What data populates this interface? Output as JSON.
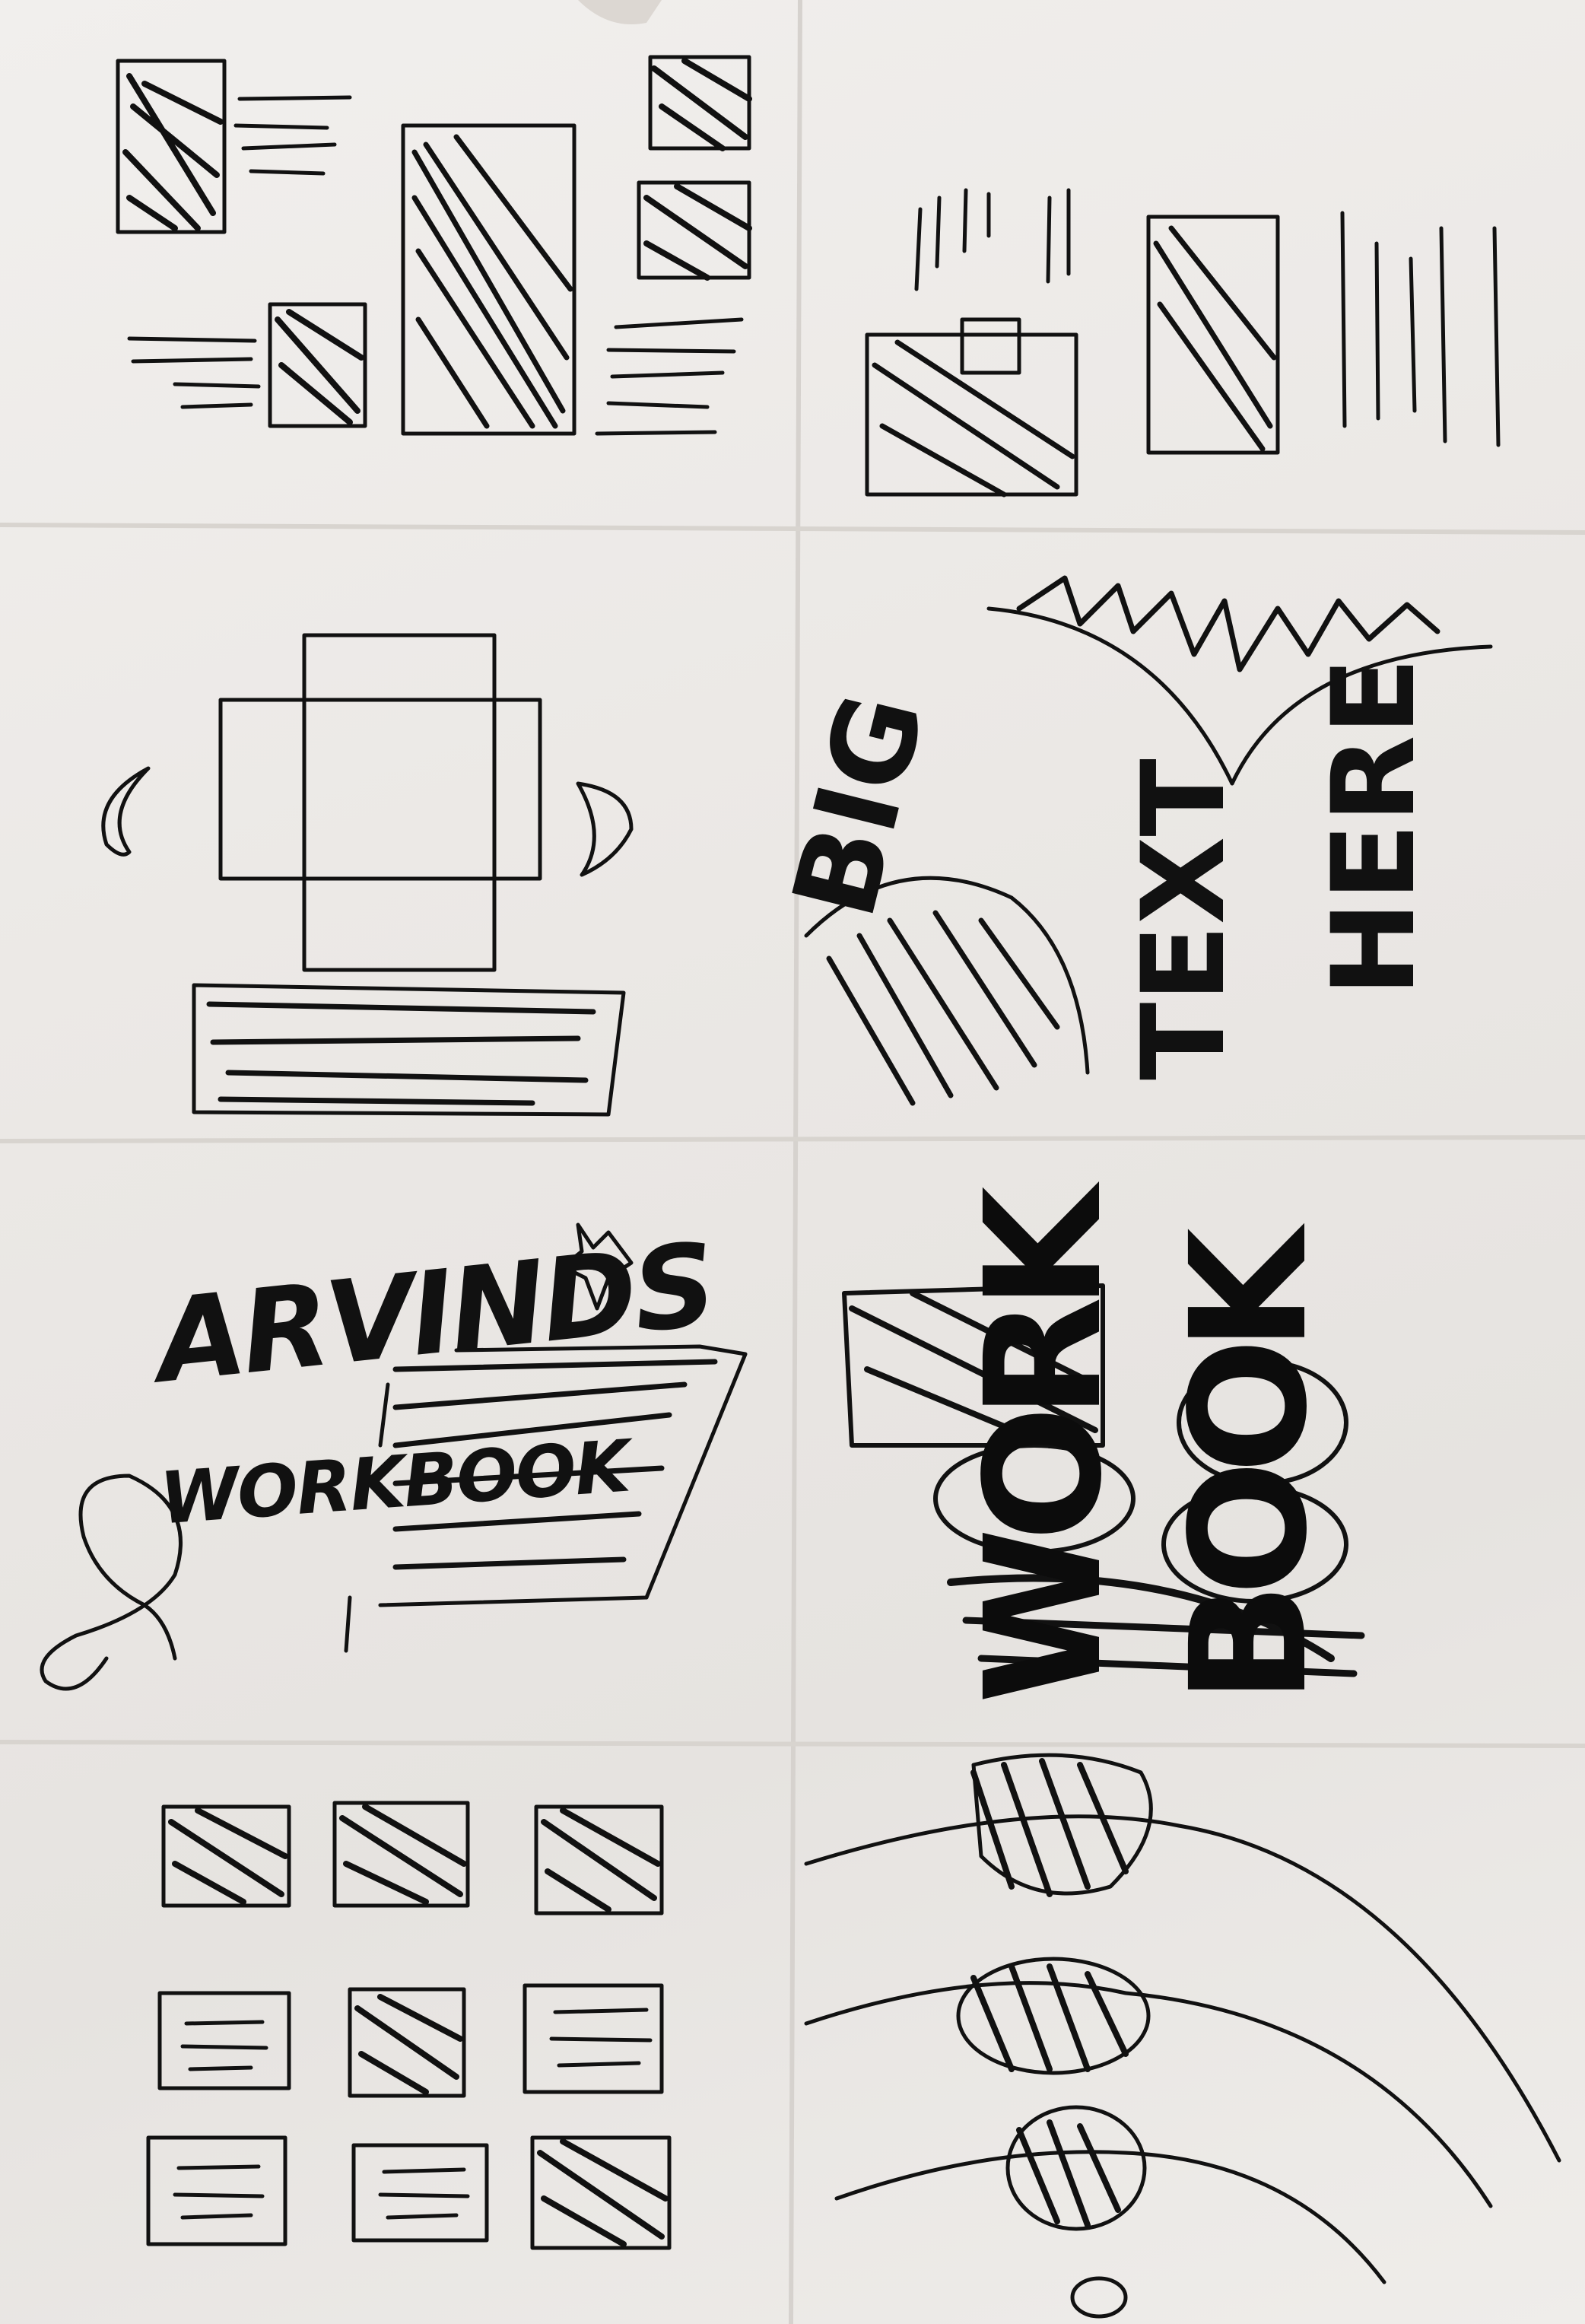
{
  "sketch": {
    "title_line_1": "ARVINDS",
    "title_line_2": "WORKBOOK",
    "big_text": [
      "BIG",
      "TEXT",
      "HERE"
    ],
    "stacked_text": [
      "WORK",
      "BOOK"
    ]
  },
  "panels": [
    "scattered-image-grid-layout",
    "vertical-text-columns-layout",
    "image-carousel-layout",
    "big-text-hero-layout",
    "workbook-title-layout",
    "stacked-workbook-title-layout",
    "thumbnail-grid-layout",
    "orbit-circles-layout"
  ],
  "colors": {
    "paper": "#ece9e6",
    "ink": "#111111"
  }
}
